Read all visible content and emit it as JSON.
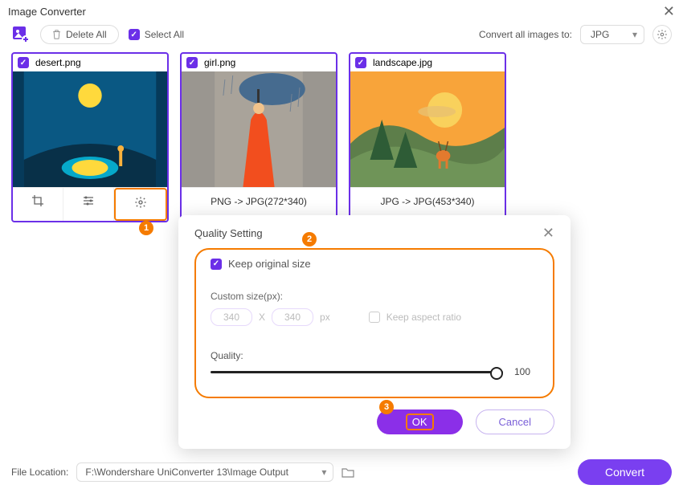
{
  "title": "Image Converter",
  "toolbar": {
    "delete_all": "Delete All",
    "select_all": "Select All",
    "convert_all_label": "Convert all images to:",
    "format": "JPG"
  },
  "cards": [
    {
      "name": "desert.png",
      "footer": ""
    },
    {
      "name": "girl.png",
      "footer": "PNG -> JPG(272*340)"
    },
    {
      "name": "landscape.jpg",
      "footer": "JPG -> JPG(453*340)"
    }
  ],
  "dialog": {
    "title": "Quality Setting",
    "keep_original": "Keep original size",
    "custom_label": "Custom size(px):",
    "w": "340",
    "h": "340",
    "px": "px",
    "aspect": "Keep aspect ratio",
    "x": "X",
    "quality_label": "Quality:",
    "quality_value": "100",
    "ok": "OK",
    "cancel": "Cancel"
  },
  "callouts": {
    "c1": "1",
    "c2": "2",
    "c3": "3"
  },
  "footer": {
    "label": "File Location:",
    "path": "F:\\Wondershare UniConverter 13\\Image Output",
    "convert": "Convert"
  }
}
